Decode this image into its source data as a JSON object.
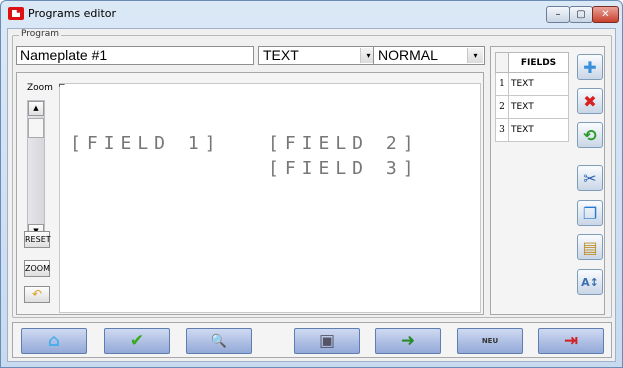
{
  "window": {
    "title": "Programs editor",
    "controls": {
      "minimize": "–",
      "maximize": "▢",
      "close": "✕"
    }
  },
  "program": {
    "group_label": "Program",
    "name": "Nameplate #1",
    "font_type": "TEXT",
    "style": "NORMAL",
    "dropdown_arrow": "▾"
  },
  "zoom": {
    "label": "Zoom",
    "reset_label": "RESET",
    "zoom_label": "ZOOM",
    "up_arrow": "▲",
    "down_arrow": "▼",
    "undo_icon": "↶"
  },
  "canvas": {
    "corner_mark": "⌐",
    "fields_text": [
      "[FIELD 1]",
      "[FIELD 2]",
      "[FIELD 3]"
    ]
  },
  "fields": {
    "header": "FIELDS",
    "rows": [
      {
        "index": "1",
        "type": "TEXT"
      },
      {
        "index": "2",
        "type": "TEXT"
      },
      {
        "index": "3",
        "type": "TEXT"
      }
    ]
  },
  "tools": {
    "add": {
      "icon": "plus-icon",
      "glyph": "✚",
      "color": "#3a8fdc"
    },
    "delete": {
      "icon": "delete-icon",
      "glyph": "✖",
      "color": "#d82020"
    },
    "back": {
      "icon": "arrow-left-icon",
      "glyph": "⟲",
      "color": "#2a9a2a"
    },
    "cut": {
      "icon": "scissors-icon",
      "glyph": "✂",
      "color": "#2a5fb0"
    },
    "copy": {
      "icon": "copy-icon",
      "glyph": "❐",
      "color": "#2a7ad0"
    },
    "paste": {
      "icon": "paste-icon",
      "glyph": "▤",
      "color": "#c0902a"
    },
    "sort": {
      "icon": "sort-az-icon",
      "glyph": "A↕",
      "color": "#3a6fb0"
    }
  },
  "bottom": {
    "home": {
      "glyph": "⌂",
      "color": "#4ab0e8"
    },
    "ok": {
      "glyph": "✔",
      "color": "#3aaa1a"
    },
    "preview": {
      "glyph": "🔍",
      "color": "#4a6a9a"
    },
    "save": {
      "glyph": "▣",
      "color": "#556"
    },
    "open": {
      "glyph": "➜",
      "color": "#2a8a2a"
    },
    "new_doc": {
      "label": "NEU"
    },
    "exit": {
      "glyph": "⇥",
      "color": "#d02020"
    }
  }
}
